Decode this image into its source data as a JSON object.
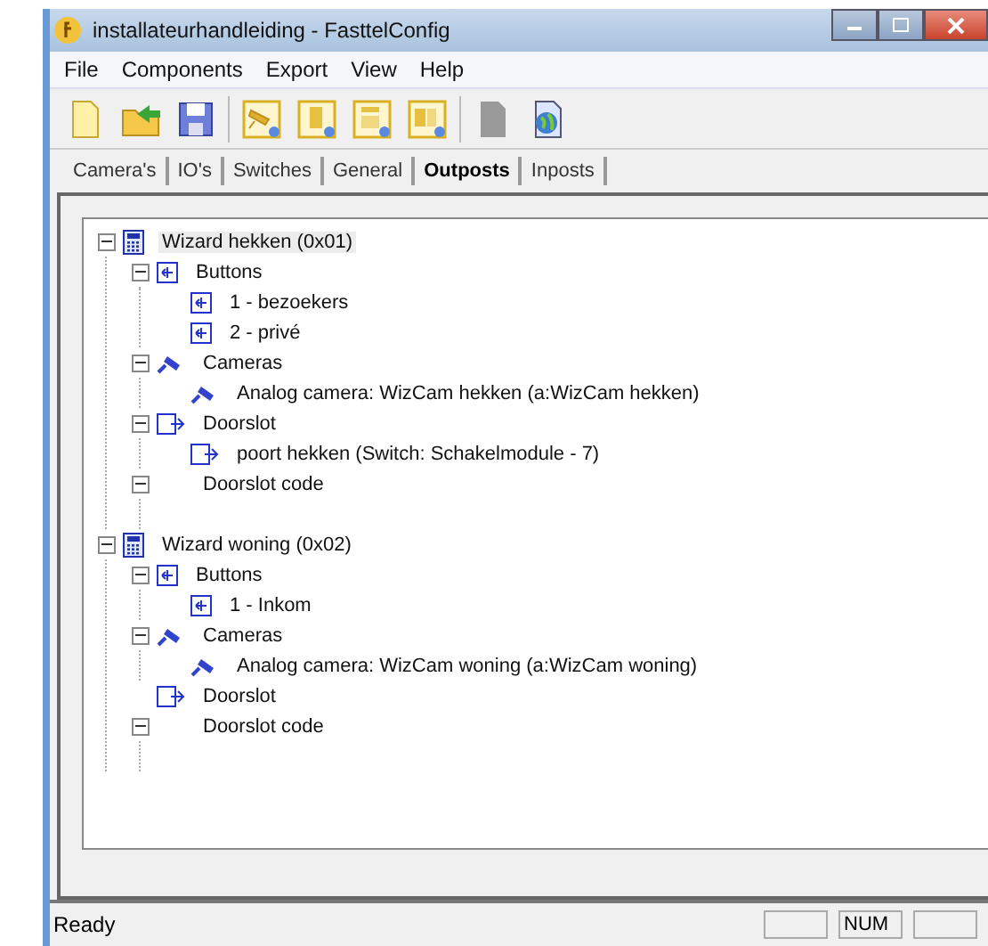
{
  "window": {
    "title": "installateurhandleiding - FasttelConfig"
  },
  "menu": [
    "File",
    "Components",
    "Export",
    "View",
    "Help"
  ],
  "tabs": [
    {
      "label": "Camera's",
      "selected": false
    },
    {
      "label": "IO's",
      "selected": false
    },
    {
      "label": "Switches",
      "selected": false
    },
    {
      "label": "General",
      "selected": false
    },
    {
      "label": "Outposts",
      "selected": true
    },
    {
      "label": "Inposts",
      "selected": false
    }
  ],
  "tree": [
    {
      "label": "Wizard hekken (0x01)",
      "kind": "device",
      "expanded": true,
      "selected": true,
      "children": [
        {
          "label": "Buttons",
          "kind": "button",
          "expanded": true,
          "children": [
            {
              "label": "1 - bezoekers",
              "kind": "button"
            },
            {
              "label": "2 - privé",
              "kind": "button"
            }
          ]
        },
        {
          "label": "Cameras",
          "kind": "camera",
          "expanded": true,
          "children": [
            {
              "label": "Analog camera: WizCam hekken (a:WizCam hekken)",
              "kind": "camera"
            }
          ]
        },
        {
          "label": "Doorslot",
          "kind": "switch",
          "expanded": true,
          "children": [
            {
              "label": "poort hekken (Switch: Schakelmodule - 7)",
              "kind": "switch"
            }
          ]
        },
        {
          "label": "Doorslot code",
          "kind": "code",
          "expanded": true
        }
      ]
    },
    {
      "label": "Wizard woning (0x02)",
      "kind": "device",
      "expanded": true,
      "selected": false,
      "children": [
        {
          "label": "Buttons",
          "kind": "button",
          "expanded": true,
          "children": [
            {
              "label": "1 - Inkom",
              "kind": "button"
            }
          ]
        },
        {
          "label": "Cameras",
          "kind": "camera",
          "expanded": true,
          "children": [
            {
              "label": "Analog camera: WizCam woning (a:WizCam woning)",
              "kind": "camera"
            }
          ]
        },
        {
          "label": "Doorslot",
          "kind": "switch"
        },
        {
          "label": "Doorslot code",
          "kind": "code",
          "expanded": true
        }
      ]
    }
  ],
  "status_bar": {
    "text": "Ready",
    "indicator": "NUM"
  }
}
